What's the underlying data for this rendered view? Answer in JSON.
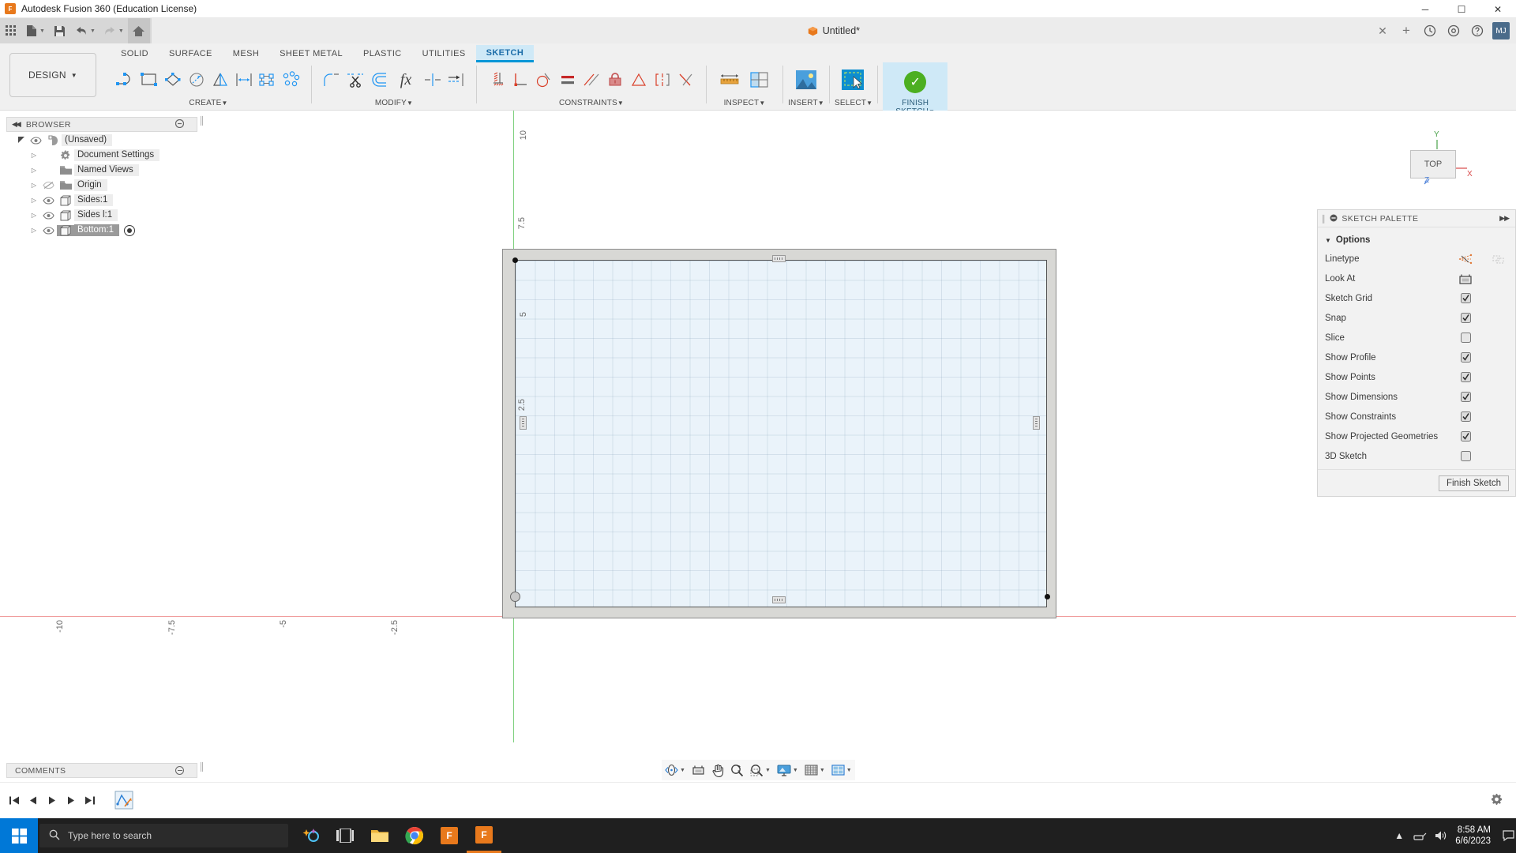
{
  "titlebar": {
    "app_title": "Autodesk Fusion 360 (Education License)",
    "logo_text": "F",
    "minimize": "─",
    "maximize": "☐",
    "close": "✕"
  },
  "quickaccess": {
    "grid_icon": "app-grid-icon",
    "new_label": "new-document",
    "save_label": "save",
    "undo_label": "undo",
    "redo_label": "redo",
    "home_label": "home",
    "document_title": "Untitled*",
    "tab_close": "✕",
    "add_tab": "+",
    "help_icon": "help-icon",
    "jobs_icon": "jobs-icon",
    "notify_icon": "notification-icon",
    "user_initials": "MJ"
  },
  "ribbon": {
    "design_button": "DESIGN",
    "tabs": [
      {
        "label": "SOLID",
        "active": false
      },
      {
        "label": "SURFACE",
        "active": false
      },
      {
        "label": "MESH",
        "active": false
      },
      {
        "label": "SHEET METAL",
        "active": false
      },
      {
        "label": "PLASTIC",
        "active": false
      },
      {
        "label": "UTILITIES",
        "active": false
      },
      {
        "label": "SKETCH",
        "active": true
      }
    ],
    "panels": [
      {
        "label": "CREATE",
        "icons": [
          "line-arc-icon",
          "rectangle-icon",
          "polygon-icon",
          "circle-icon",
          "mirror-icon",
          "dimension-icon",
          "rectangular-pattern-icon",
          "circular-pattern-icon"
        ]
      },
      {
        "label": "MODIFY",
        "icons": [
          "fillet-icon",
          "trim-icon",
          "offset-icon",
          "fx-parameters-icon",
          "break-icon",
          "extend-icon"
        ]
      },
      {
        "label": "CONSTRAINTS",
        "icons": [
          "fix-unfix-icon",
          "perpendicular-icon",
          "tangent-icon",
          "equal-icon",
          "parallel-icon",
          "lock-constraint-icon",
          "symmetry-icon",
          "midpoint-icon",
          "coincident-icon"
        ]
      },
      {
        "label": "INSPECT",
        "icons": [
          "measure-icon",
          "section-analysis-icon"
        ]
      },
      {
        "label": "INSERT",
        "icons": [
          "insert-image-icon"
        ]
      },
      {
        "label": "SELECT",
        "icons": [
          "select-window-icon"
        ]
      }
    ],
    "finish_sketch": "FINISH SKETCH",
    "inspect_label": "INSPECT",
    "insert_label": "INSERT",
    "select_label": "SELECT"
  },
  "browser": {
    "title": "BROWSER",
    "nodes": [
      {
        "label": "(Unsaved)",
        "icon": "document-icon",
        "eye": "visible",
        "twisty": "expanded",
        "indent": 0,
        "selected": false,
        "active": false
      },
      {
        "label": "Document Settings",
        "icon": "gear-icon",
        "eye": "none",
        "twisty": "collapsed",
        "indent": 1,
        "selected": false,
        "active": false
      },
      {
        "label": "Named Views",
        "icon": "folder-icon",
        "eye": "none",
        "twisty": "collapsed",
        "indent": 1,
        "selected": false,
        "active": false
      },
      {
        "label": "Origin",
        "icon": "folder-icon",
        "eye": "hidden",
        "twisty": "collapsed",
        "indent": 1,
        "selected": false,
        "active": false
      },
      {
        "label": "Sides:1",
        "icon": "body-icon",
        "eye": "visible",
        "twisty": "collapsed",
        "indent": 1,
        "selected": false,
        "active": false
      },
      {
        "label": "Sides l:1",
        "icon": "body-icon",
        "eye": "visible",
        "twisty": "collapsed",
        "indent": 1,
        "selected": false,
        "active": false
      },
      {
        "label": "Bottom:1",
        "icon": "body-icon",
        "eye": "visible",
        "twisty": "collapsed",
        "indent": 1,
        "selected": true,
        "active": true
      }
    ]
  },
  "sketch_palette": {
    "title": "SKETCH PALETTE",
    "section": "Options",
    "expand_icon": "▸▸",
    "collapse_icon": "⊖",
    "rows": [
      {
        "label": "Linetype",
        "control": "linetype-icons"
      },
      {
        "label": "Look At",
        "control": "lookat-icon"
      },
      {
        "label": "Sketch Grid",
        "control": "checkbox",
        "checked": true
      },
      {
        "label": "Snap",
        "control": "checkbox",
        "checked": true
      },
      {
        "label": "Slice",
        "control": "checkbox",
        "checked": false
      },
      {
        "label": "Show Profile",
        "control": "checkbox",
        "checked": true
      },
      {
        "label": "Show Points",
        "control": "checkbox",
        "checked": true
      },
      {
        "label": "Show Dimensions",
        "control": "checkbox",
        "checked": true
      },
      {
        "label": "Show Constraints",
        "control": "checkbox",
        "checked": true
      },
      {
        "label": "Show Projected Geometries",
        "control": "checkbox",
        "checked": true
      },
      {
        "label": "3D Sketch",
        "control": "checkbox",
        "checked": false
      }
    ],
    "finish_button": "Finish Sketch"
  },
  "canvas": {
    "viewcube_label": "TOP",
    "axis_x": "X",
    "axis_y": "Y",
    "axis_z": "Z",
    "horizontal_ticks": [
      "-10",
      "-7.5",
      "-5",
      "-2.5"
    ],
    "vertical_ticks": [
      "10",
      "7.5",
      "5",
      "2.5"
    ],
    "grid_color": "#7896af",
    "profile_fill": "#eaf3fa",
    "projected_fill": "#d8d8d5",
    "x_axis_color": "#f09c9c",
    "y_axis_color": "#7fd07f"
  },
  "comments": {
    "title": "COMMENTS"
  },
  "navbar": {
    "items": [
      "orbit-icon",
      "look-at-icon",
      "pan-icon",
      "zoom-icon",
      "zoom-window-icon",
      "display-settings-icon",
      "grid-snaps-icon",
      "viewports-icon"
    ]
  },
  "timeline": {
    "buttons": [
      "go-to-beginning-icon",
      "step-back-icon",
      "play-icon",
      "step-forward-icon",
      "go-to-end-icon"
    ],
    "feature": "sketch-feature-icon",
    "settings": "timeline-settings-icon"
  },
  "taskbar": {
    "start": "windows-start-icon",
    "search_placeholder": "Type here to search",
    "apps": [
      "task-view-icon",
      "file-explorer-icon",
      "chrome-icon",
      "fusion360-icon",
      "fusion360-active-icon"
    ],
    "tray": [
      "show-hidden-icons-icon",
      "network-icon",
      "volume-icon"
    ],
    "time": "8:58 AM",
    "date": "6/6/2023",
    "action_center": "notifications-icon"
  }
}
